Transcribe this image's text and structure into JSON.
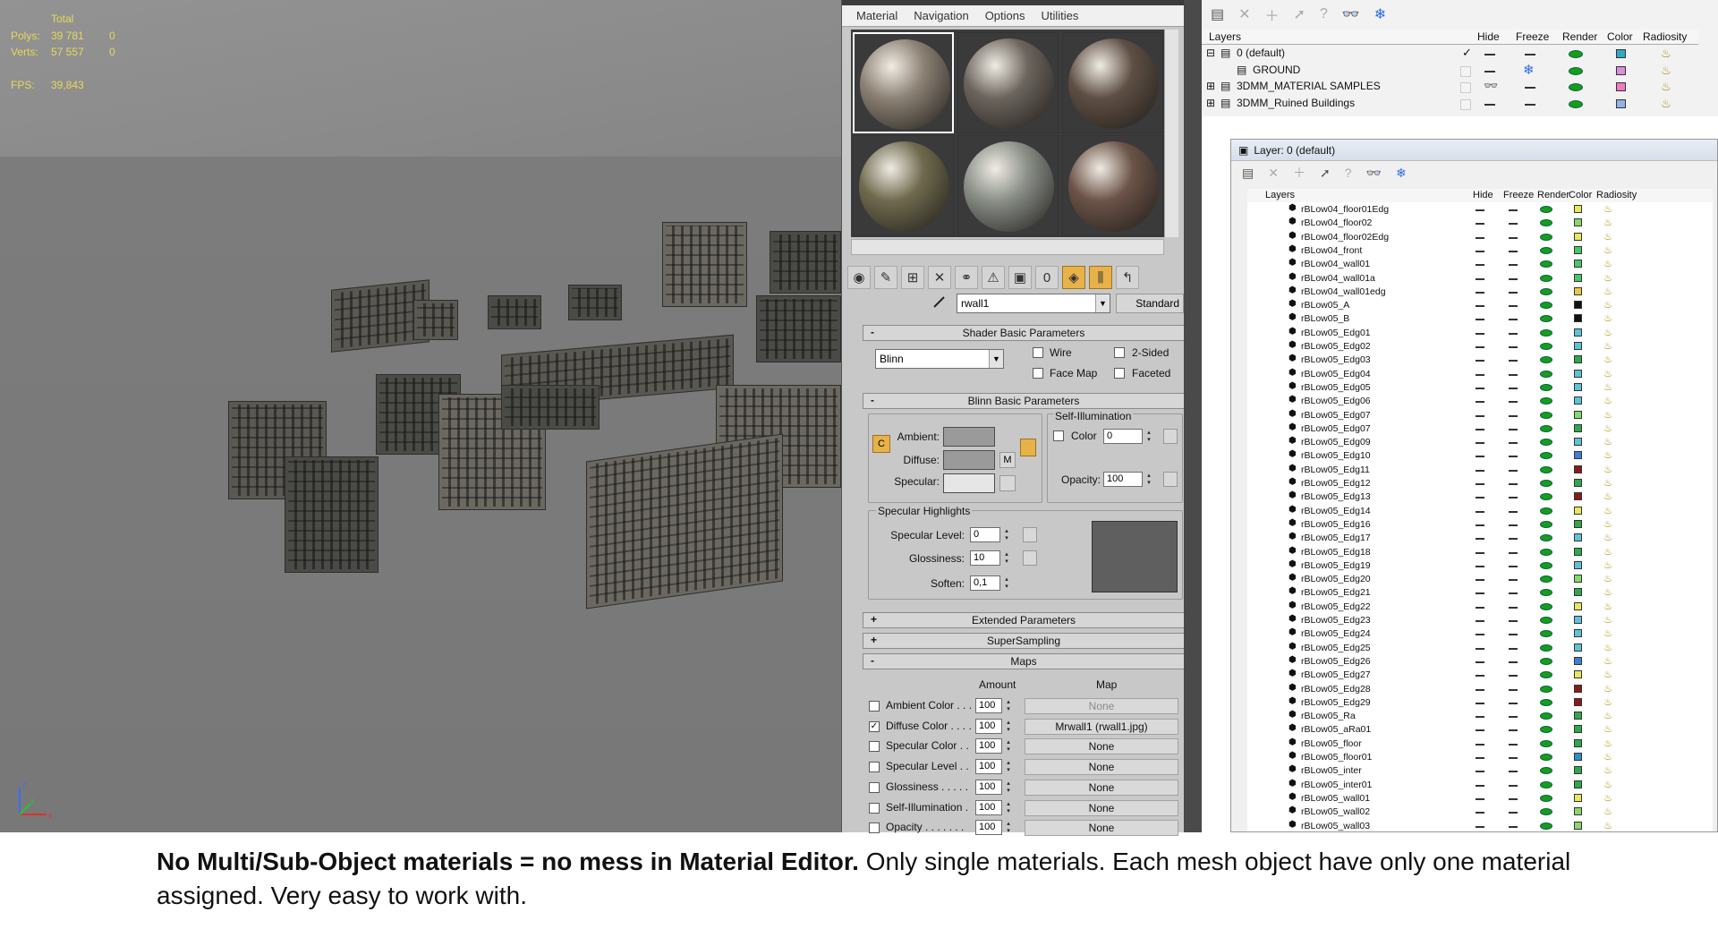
{
  "viewport": {
    "stats": {
      "total_label": "Total",
      "polys_label": "Polys:",
      "polys_total": "39 781",
      "polys_sel": "0",
      "verts_label": "Verts:",
      "verts_total": "57 557",
      "verts_sel": "0",
      "fps_label": "FPS:",
      "fps_value": "39,843"
    },
    "axis": {
      "x": "x",
      "y": "y",
      "z": "z"
    }
  },
  "material_editor": {
    "menu": [
      "Material",
      "Navigation",
      "Options",
      "Utilities"
    ],
    "slots": [
      {
        "color": "#8b8174",
        "selected": true
      },
      {
        "color": "#6c655e",
        "selected": false
      },
      {
        "color": "#5e4f44",
        "selected": false
      },
      {
        "color": "#6f6a4e",
        "selected": false
      },
      {
        "color": "#8a8f88",
        "selected": false
      },
      {
        "color": "#6b5348",
        "selected": false
      }
    ],
    "material_name": "rwall1",
    "material_type": "Standard",
    "shader_rollout": {
      "title": "Shader Basic Parameters",
      "sign": "-",
      "shader": "Blinn",
      "wire_label": "Wire",
      "two_sided_label": "2-Sided",
      "facemap_label": "Face Map",
      "faceted_label": "Faceted"
    },
    "blinn_rollout": {
      "title": "Blinn Basic Parameters",
      "sign": "-",
      "ambient_label": "Ambient:",
      "diffuse_label": "Diffuse:",
      "specular_label": "Specular:",
      "m_label": "M",
      "c_label": "C",
      "self_illum_label": "Self-Illumination",
      "color_label": "Color",
      "color_value": "0",
      "opacity_label": "Opacity:",
      "opacity_value": "100",
      "ambient_color": "#9a9a9a",
      "diffuse_color": "#9a9a9a",
      "specular_color": "#e6e6e6",
      "specular_highlights_label": "Specular Highlights",
      "spec_level_label": "Specular Level:",
      "spec_level_value": "0",
      "glossiness_label": "Glossiness:",
      "glossiness_value": "10",
      "soften_label": "Soften:",
      "soften_value": "0,1"
    },
    "collapsed_rollouts": [
      {
        "title": "Extended Parameters",
        "sign": "+"
      },
      {
        "title": "SuperSampling",
        "sign": "+"
      }
    ],
    "maps_rollout": {
      "title": "Maps",
      "sign": "-",
      "amount_header": "Amount",
      "map_header": "Map",
      "rows": [
        {
          "label": "Ambient Color . . .",
          "checked": false,
          "amount": "100",
          "map": "None",
          "disabled": true
        },
        {
          "label": "Diffuse Color . . . .",
          "checked": true,
          "amount": "100",
          "map": "Mrwall1 (rwall1.jpg)",
          "disabled": false
        },
        {
          "label": "Specular Color . .",
          "checked": false,
          "amount": "100",
          "map": "None",
          "disabled": false
        },
        {
          "label": "Specular Level . .",
          "checked": false,
          "amount": "100",
          "map": "None",
          "disabled": false
        },
        {
          "label": "Glossiness . . . . .",
          "checked": false,
          "amount": "100",
          "map": "None",
          "disabled": false
        },
        {
          "label": "Self-Illumination .",
          "checked": false,
          "amount": "100",
          "map": "None",
          "disabled": false
        },
        {
          "label": "Opacity . . . . . . .",
          "checked": false,
          "amount": "100",
          "map": "None",
          "disabled": false
        }
      ]
    }
  },
  "layer_manager": {
    "headers": {
      "layers": "Layers",
      "hide": "Hide",
      "freeze": "Freeze",
      "render": "Render",
      "color": "Color",
      "radiosity": "Radiosity"
    },
    "rows": [
      {
        "name": "0 (default)",
        "active": true,
        "expand": "⊟",
        "hide": "dash",
        "freeze": "dash",
        "color": "#2fa7c8"
      },
      {
        "name": "GROUND",
        "active": false,
        "expand": "",
        "hide": "dash",
        "freeze": "snow",
        "color": "#d98fd9"
      },
      {
        "name": "3DMM_MATERIAL SAMPLES",
        "active": false,
        "expand": "⊞",
        "hide": "glasses",
        "freeze": "dash",
        "color": "#f07bc4"
      },
      {
        "name": "3DMM_Ruined Buildings",
        "active": false,
        "expand": "⊞",
        "hide": "dash",
        "freeze": "dash",
        "color": "#8fb4e8"
      }
    ]
  },
  "layer_window": {
    "title": "Layer: 0 (default)",
    "headers": {
      "layers": "Layers",
      "hide": "Hide",
      "freeze": "Freeze",
      "render": "Render",
      "color": "Color",
      "radiosity": "Radiosity"
    },
    "objects": [
      {
        "name": "rBLow04_floor01Edg",
        "color": "#e8e85c"
      },
      {
        "name": "rBLow04_floor02",
        "color": "#86d96b"
      },
      {
        "name": "rBLow04_floor02Edg",
        "color": "#e8e85c"
      },
      {
        "name": "rBLow04_front",
        "color": "#4cc46b"
      },
      {
        "name": "rBLow04_wall01",
        "color": "#4cc46b"
      },
      {
        "name": "rBLow04_wall01a",
        "color": "#4cc46b"
      },
      {
        "name": "rBLow04_wall01edg",
        "color": "#e6c84a"
      },
      {
        "name": "rBLow05_A",
        "color": "#111111"
      },
      {
        "name": "rBLow05_B",
        "color": "#111111"
      },
      {
        "name": "rBLow05_Edg01",
        "color": "#5ec2d9"
      },
      {
        "name": "rBLow05_Edg02",
        "color": "#5ec2d9"
      },
      {
        "name": "rBLow05_Edg03",
        "color": "#2ea84a"
      },
      {
        "name": "rBLow05_Edg04",
        "color": "#5ec2d9"
      },
      {
        "name": "rBLow05_Edg05",
        "color": "#5ec2d9"
      },
      {
        "name": "rBLow05_Edg06",
        "color": "#5ec2d9"
      },
      {
        "name": "rBLow05_Edg07",
        "color": "#86d96b"
      },
      {
        "name": "rBLow05_Edg07",
        "color": "#2ea84a"
      },
      {
        "name": "rBLow05_Edg09",
        "color": "#5ec2d9"
      },
      {
        "name": "rBLow05_Edg10",
        "color": "#3b7fd9"
      },
      {
        "name": "rBLow05_Edg11",
        "color": "#8a1a1a"
      },
      {
        "name": "rBLow05_Edg12",
        "color": "#2ea84a"
      },
      {
        "name": "rBLow05_Edg13",
        "color": "#8a1a1a"
      },
      {
        "name": "rBLow05_Edg14",
        "color": "#e8e85c"
      },
      {
        "name": "rBLow05_Edg16",
        "color": "#2ea84a"
      },
      {
        "name": "rBLow05_Edg17",
        "color": "#5ec2d9"
      },
      {
        "name": "rBLow05_Edg18",
        "color": "#2ea84a"
      },
      {
        "name": "rBLow05_Edg19",
        "color": "#5ec2d9"
      },
      {
        "name": "rBLow05_Edg20",
        "color": "#86d96b"
      },
      {
        "name": "rBLow05_Edg21",
        "color": "#2ea84a"
      },
      {
        "name": "rBLow05_Edg22",
        "color": "#e8e85c"
      },
      {
        "name": "rBLow05_Edg23",
        "color": "#5ec2d9"
      },
      {
        "name": "rBLow05_Edg24",
        "color": "#5ec2d9"
      },
      {
        "name": "rBLow05_Edg25",
        "color": "#5ec2d9"
      },
      {
        "name": "rBLow05_Edg26",
        "color": "#3b7fd9"
      },
      {
        "name": "rBLow05_Edg27",
        "color": "#e8e85c"
      },
      {
        "name": "rBLow05_Edg28",
        "color": "#8a1a1a"
      },
      {
        "name": "rBLow05_Edg29",
        "color": "#8a1a1a"
      },
      {
        "name": "rBLow05_Ra",
        "color": "#2ea84a"
      },
      {
        "name": "rBLow05_aRa01",
        "color": "#2ea84a"
      },
      {
        "name": "rBLow05_floor",
        "color": "#2ea84a"
      },
      {
        "name": "rBLow05_floor01",
        "color": "#2e8fc8"
      },
      {
        "name": "rBLow05_inter",
        "color": "#2ea84a"
      },
      {
        "name": "rBLow05_inter01",
        "color": "#2ea84a"
      },
      {
        "name": "rBLow05_wall01",
        "color": "#e8e85c"
      },
      {
        "name": "rBLow05_wall02",
        "color": "#86d96b"
      },
      {
        "name": "rBLow05_wall03",
        "color": "#86d96b"
      }
    ]
  },
  "caption": {
    "bold": "No Multi/Sub-Object materials = no mess in Material Editor.",
    "normal": " Only single materials. Each mesh object have only one material assigned. Very easy to work with."
  }
}
